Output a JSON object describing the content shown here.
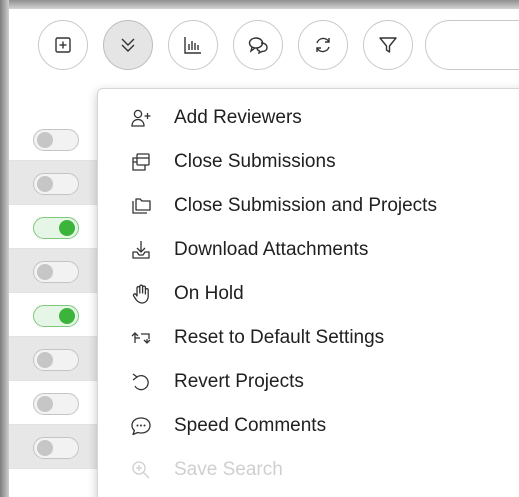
{
  "toolbar": {
    "buttons": [
      {
        "name": "add-box-icon",
        "active": false
      },
      {
        "name": "double-chevron-down-icon",
        "active": true
      },
      {
        "name": "bar-chart-icon",
        "active": false
      },
      {
        "name": "chat-bubbles-icon",
        "active": false
      },
      {
        "name": "refresh-icon",
        "active": false
      },
      {
        "name": "filter-icon",
        "active": false
      }
    ],
    "search_value": ""
  },
  "rows": [
    {
      "shaded": false,
      "toggle": "off"
    },
    {
      "shaded": true,
      "toggle": "off"
    },
    {
      "shaded": false,
      "toggle": "on"
    },
    {
      "shaded": true,
      "toggle": "off"
    },
    {
      "shaded": false,
      "toggle": "on"
    },
    {
      "shaded": true,
      "toggle": "off"
    },
    {
      "shaded": false,
      "toggle": "off"
    },
    {
      "shaded": true,
      "toggle": "off"
    }
  ],
  "menu": {
    "items": [
      {
        "label": "Add Reviewers",
        "icon": "add-user-icon",
        "enabled": true
      },
      {
        "label": "Close Submissions",
        "icon": "stacked-windows-icon",
        "enabled": true
      },
      {
        "label": "Close Submission and Projects",
        "icon": "folders-icon",
        "enabled": true
      },
      {
        "label": "Download Attachments",
        "icon": "download-tray-icon",
        "enabled": true
      },
      {
        "label": "On Hold",
        "icon": "hand-icon",
        "enabled": true
      },
      {
        "label": "Reset to Default Settings",
        "icon": "reset-arrows-icon",
        "enabled": true
      },
      {
        "label": "Revert Projects",
        "icon": "undo-icon",
        "enabled": true
      },
      {
        "label": "Speed Comments",
        "icon": "comment-icon",
        "enabled": true
      },
      {
        "label": "Save Search",
        "icon": "zoom-in-icon",
        "enabled": false
      }
    ]
  },
  "colors": {
    "toggle_on": "#3cb43c",
    "menu_text": "#202020",
    "disabled_text": "#cfcfcf"
  }
}
